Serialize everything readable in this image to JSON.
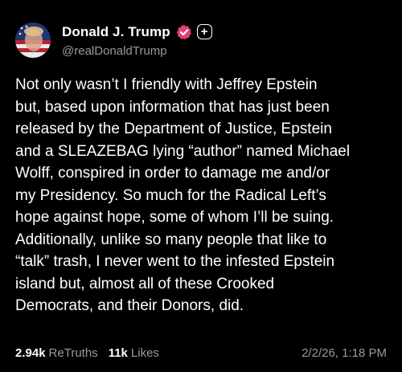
{
  "author": {
    "display_name": "Donald J. Trump",
    "handle": "@realDonaldTrump",
    "verified_icon": "verified-badge-icon",
    "follow_icon": "plus-icon",
    "follow_symbol": "+"
  },
  "post": {
    "text": "Not only wasn’t I friendly with Jeffrey Epstein\nbut, based upon information that has just been\nreleased by the Department of Justice, Epstein\nand a SLEAZEBAG lying “author” named Michael\nWolff, conspired in order to damage me and/or\nmy Presidency. So much for the Radical Left’s\nhope against hope, some of whom I’ll be suing.\nAdditionally, unlike so many people that like to\n“talk” trash, I never went to the infested Epstein\nisland but, almost all of these Crooked\nDemocrats, and their Donors, did."
  },
  "stats": {
    "retruths_count": "2.94k",
    "retruths_label": "ReTruths",
    "likes_count": "11k",
    "likes_label": "Likes",
    "timestamp": "2/2/26, 1:18 PM"
  },
  "colors": {
    "background": "#000000",
    "text": "#ffffff",
    "muted": "#9a9a9a",
    "verified": "#e0407e"
  }
}
